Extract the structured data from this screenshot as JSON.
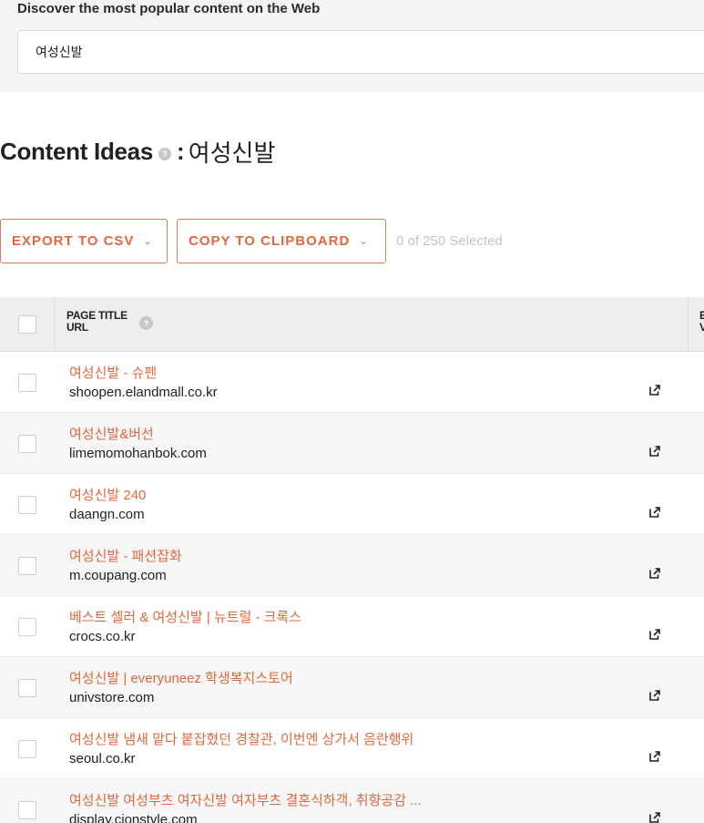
{
  "search": {
    "heading": "Discover the most popular content on the Web",
    "value": "여성신발"
  },
  "header": {
    "title": "Content Ideas",
    "help_glyph": "?",
    "colon": ":",
    "keyword": "여성신발"
  },
  "toolbar": {
    "export_label": "EXPORT TO CSV",
    "copy_label": "COPY TO CLIPBOARD",
    "chevron": "⌄",
    "selected_text": "0 of 250 Selected"
  },
  "table": {
    "col_title_line1": "PAGE TITLE",
    "col_title_line2": "URL",
    "col_next_line1": "E",
    "col_next_line2": "V",
    "rows": [
      {
        "title": "여성신발 - 슈펜",
        "url": "shoopen.elandmall.co.kr"
      },
      {
        "title": "여성신발&버선",
        "url": "limemomohanbok.com"
      },
      {
        "title": "여성신발 240",
        "url": "daangn.com"
      },
      {
        "title": "여성신발 - 패션잡화",
        "url": "m.coupang.com"
      },
      {
        "title": "베스트 셀러 & 여성신발 | 뉴트럴 - 크록스",
        "url": "crocs.co.kr"
      },
      {
        "title": "여성신발 | everyuneez 학생복지스토어",
        "url": "univstore.com"
      },
      {
        "title": "여성신발 냄새 맡다 붙잡혔던 경찰관, 이번엔 상가서 음란행위",
        "url": "seoul.co.kr"
      },
      {
        "title": "여성신발 여성부츠 여자신발 여자부츠 결혼식하객, 취향공감 ...",
        "url": "display.cjonstyle.com"
      }
    ]
  },
  "icons": {
    "help": "help-icon",
    "external_link": "external-link-icon",
    "chevron": "chevron-down-icon"
  },
  "colors": {
    "accent": "#e0683f",
    "panel_bg": "#f4f4f4",
    "muted": "#c4c4c4"
  }
}
